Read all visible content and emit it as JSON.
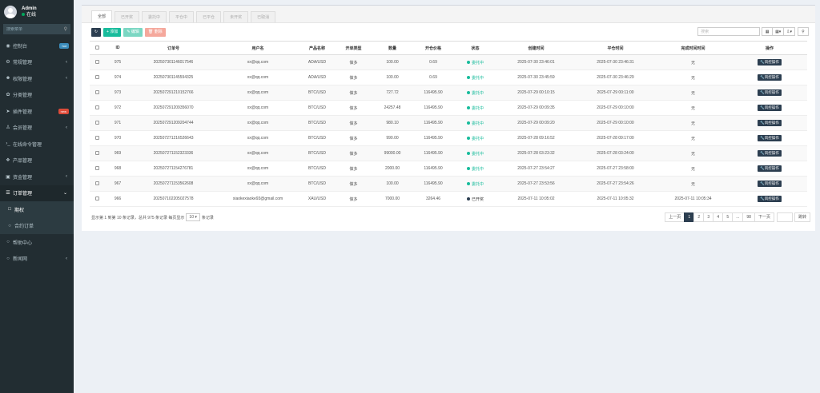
{
  "user": {
    "name": "Admin",
    "status": "在线"
  },
  "sidebar": {
    "search_placeholder": "搜索菜单",
    "items": [
      {
        "label": "控制台",
        "badge": "hot"
      },
      {
        "label": "常规管理"
      },
      {
        "label": "权限管理"
      },
      {
        "label": "分类管理"
      },
      {
        "label": "插件管理",
        "badge": "new"
      },
      {
        "label": "会员管理"
      },
      {
        "label": "在线命令管理"
      },
      {
        "label": "产品管理"
      },
      {
        "label": "资金管理"
      },
      {
        "label": "订单管理"
      },
      {
        "label": "期权"
      },
      {
        "label": "合约订单"
      },
      {
        "label": "帮助中心"
      },
      {
        "label": "新闻网"
      }
    ]
  },
  "tabs": [
    "全部",
    "已开奖",
    "委托中",
    "平仓中",
    "已平仓",
    "未开奖",
    "已取消"
  ],
  "toolbar": {
    "add": "添加",
    "edit": "编辑",
    "delete": "删除",
    "search_placeholder": "搜索"
  },
  "table": {
    "headers": [
      "ID",
      "订单号",
      "用户名",
      "产品名称",
      "开单类型",
      "数量",
      "开仓价格",
      "状态",
      "创建时间",
      "平仓时间",
      "完成时间时间",
      "操作"
    ],
    "op_label": "风控操作",
    "rows": [
      {
        "id": "975",
        "order": "20250730114601754​6",
        "user": "xx@qq.com",
        "product": "ADA/USD",
        "type": "做多",
        "qty": "100.00",
        "price": "0.69",
        "status": "委托中",
        "created": "2025-07-30 23:46:01",
        "closed": "2025-07-30 23:46:31",
        "done": "无"
      },
      {
        "id": "974",
        "order": "20250730114559432​5",
        "user": "xx@qq.com",
        "product": "ADA/USD",
        "type": "做多",
        "qty": "100.00",
        "price": "0.69",
        "status": "委托中",
        "created": "2025-07-30 23:45:59",
        "closed": "2025-07-30 23:46:29",
        "done": "无"
      },
      {
        "id": "973",
        "order": "20250729121015276​6",
        "user": "xx@qq.com",
        "product": "BTC/USD",
        "type": "做多",
        "qty": "727.72",
        "price": "116495.90",
        "status": "委托中",
        "created": "2025-07-29 00:10:15",
        "closed": "2025-07-29 00:11:00",
        "done": "无"
      },
      {
        "id": "972",
        "order": "20250729120935607​0",
        "user": "xx@qq.com",
        "product": "BTC/USD",
        "type": "做多",
        "qty": "24257.48",
        "price": "116495.90",
        "status": "委托中",
        "created": "2025-07-29 00:09:35",
        "closed": "2025-07-29 00:10:00",
        "done": "无"
      },
      {
        "id": "971",
        "order": "20250729120920474​4",
        "user": "xx@qq.com",
        "product": "BTC/USD",
        "type": "做多",
        "qty": "980.10",
        "price": "116495.90",
        "status": "委托中",
        "created": "2025-07-29 00:09:20",
        "closed": "2025-07-29 00:10:00",
        "done": "无"
      },
      {
        "id": "970",
        "order": "20250727121652664​3",
        "user": "xx@qq.com",
        "product": "BTC/USD",
        "type": "做多",
        "qty": "990.00",
        "price": "116495.90",
        "status": "委托中",
        "created": "2025-07-28 09:16:52",
        "closed": "2025-07-28 09:17:00",
        "done": "无"
      },
      {
        "id": "969",
        "order": "20250727115232333​6",
        "user": "xx@qq.com",
        "product": "BTC/USD",
        "type": "做多",
        "qty": "99000.00",
        "price": "116495.90",
        "status": "委托中",
        "created": "2025-07-28 03:23:32",
        "closed": "2025-07-28 03:24:00",
        "done": "无"
      },
      {
        "id": "968",
        "order": "20250727115427678​1",
        "user": "xx@qq.com",
        "product": "BTC/USD",
        "type": "做多",
        "qty": "2000.00",
        "price": "116495.90",
        "status": "委托中",
        "created": "2025-07-27 23:54:27",
        "closed": "2025-07-27 23:58:00",
        "done": "无"
      },
      {
        "id": "967",
        "order": "20250727115356260​8",
        "user": "xx@qq.com",
        "product": "BTC/USD",
        "type": "做多",
        "qty": "100.00",
        "price": "116495.90",
        "status": "委托中",
        "created": "2025-07-27 23:53:56",
        "closed": "2025-07-27 23:54:26",
        "done": "无"
      },
      {
        "id": "966",
        "order": "20250710220502757​8",
        "user": "xiaokexiaoke93@gmail.com",
        "product": "XAU/USD",
        "type": "做多",
        "qty": "7000.00",
        "price": "3264.46",
        "status": "已开奖",
        "created": "2025-07-11 10:05:02",
        "closed": "2025-07-11 10:05:32",
        "done": "2025-07-11 10:05:34"
      }
    ]
  },
  "pagination": {
    "info_prefix": "显示第 1 到第 10 条记录，总共 975 条记录 每页显示",
    "page_size": "10",
    "info_suffix": "条记录",
    "prev": "上一页",
    "pages": [
      "1",
      "2",
      "3",
      "4",
      "5",
      "...",
      "98"
    ],
    "next": "下一页",
    "go": "跳转"
  },
  "colors": {
    "sidebar": "#222d32",
    "active": "#3c8dbc",
    "add": "#18bc9c",
    "dark": "#2c3e50"
  }
}
